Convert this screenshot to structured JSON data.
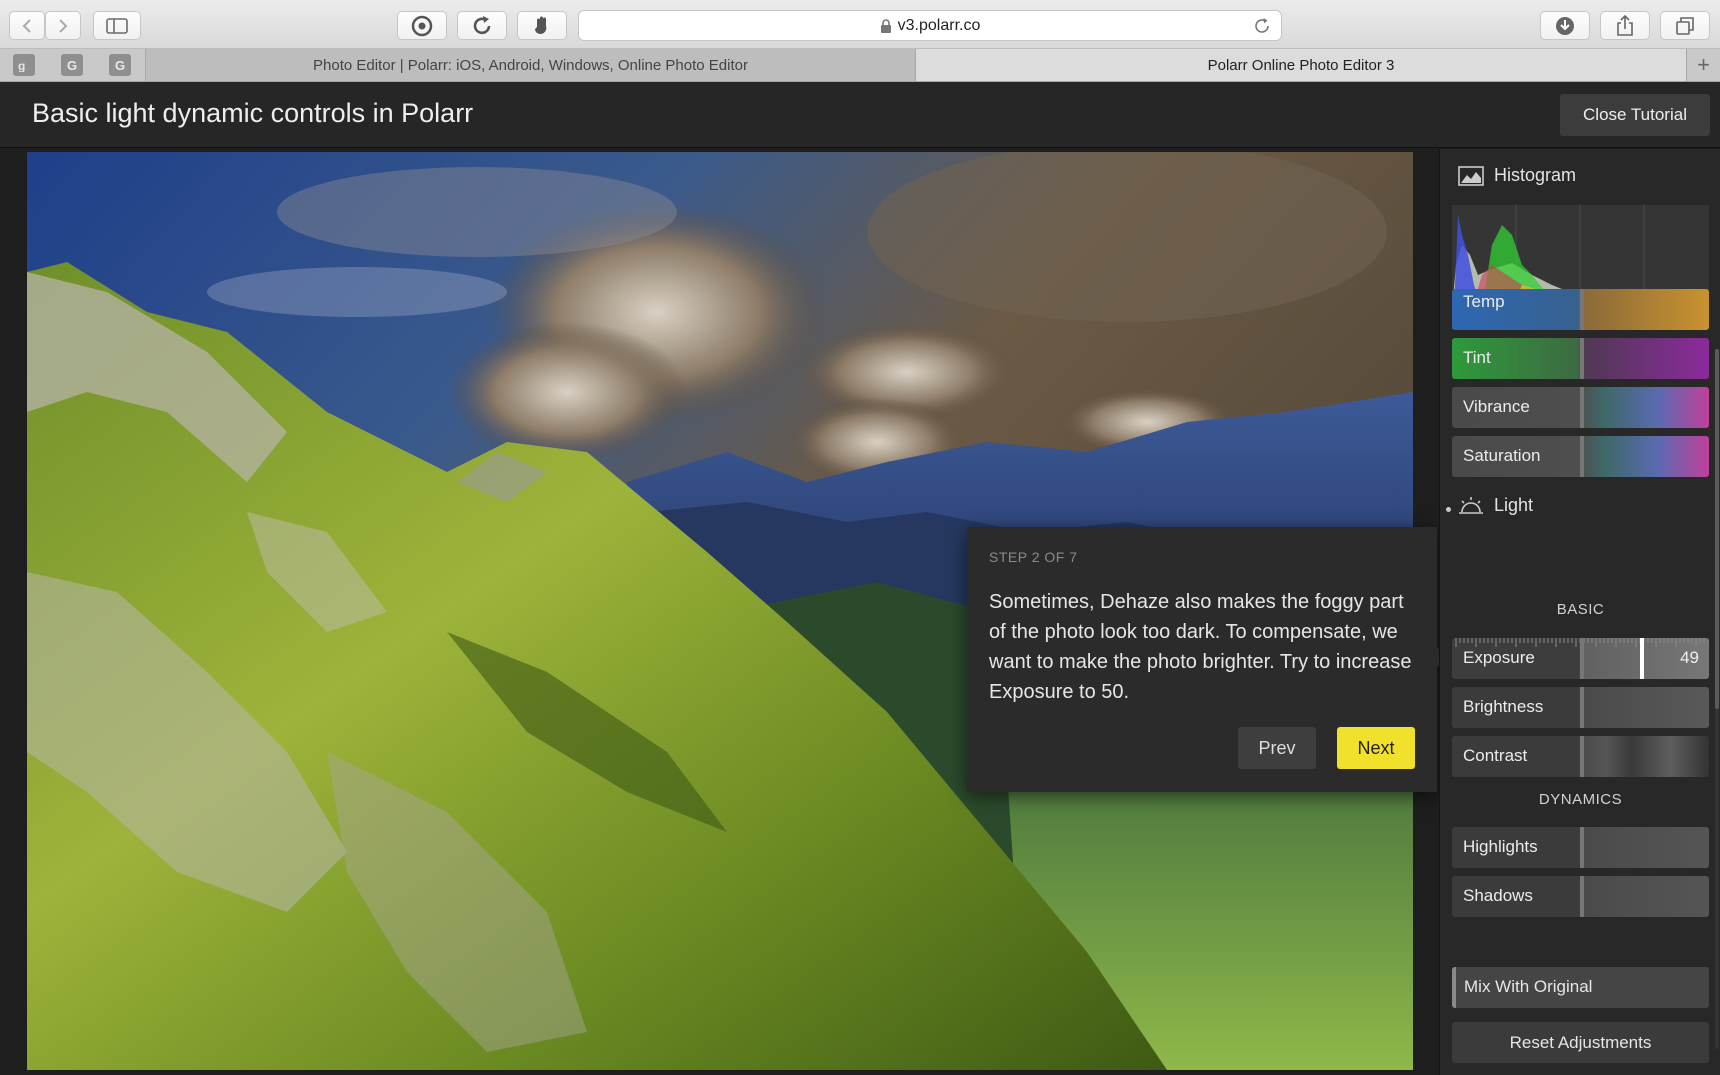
{
  "browser": {
    "url": "v3.polarr.co",
    "tabs": [
      {
        "title": "Photo Editor | Polarr: iOS, Android, Windows, Online Photo Editor",
        "active": false
      },
      {
        "title": "Polarr Online Photo Editor 3",
        "active": true
      }
    ],
    "pinned_tabs": [
      "G",
      "G"
    ]
  },
  "header": {
    "title": "Basic light dynamic controls in Polarr",
    "close_button": "Close Tutorial"
  },
  "tutorial": {
    "step": "STEP 2 OF 7",
    "text": "Sometimes, Dehaze also makes the foggy part of the photo look too dark. To compensate, we want to make the photo brighter. Try to increase Exposure to 50.",
    "prev_label": "Prev",
    "next_label": "Next",
    "next_color": "#f2e12b"
  },
  "panel": {
    "histogram_label": "Histogram",
    "color_sliders": [
      {
        "label": "Temp"
      },
      {
        "label": "Tint"
      },
      {
        "label": "Vibrance"
      },
      {
        "label": "Saturation"
      }
    ],
    "light_label": "Light",
    "basic_label": "BASIC",
    "basic_sliders": [
      {
        "label": "Exposure",
        "value": "49",
        "position": 0.74
      },
      {
        "label": "Brightness"
      },
      {
        "label": "Contrast"
      }
    ],
    "dynamics_label": "DYNAMICS",
    "dynamics_sliders": [
      {
        "label": "Highlights"
      },
      {
        "label": "Shadows"
      }
    ],
    "mix_label": "Mix With Original",
    "reset_label": "Reset Adjustments"
  }
}
